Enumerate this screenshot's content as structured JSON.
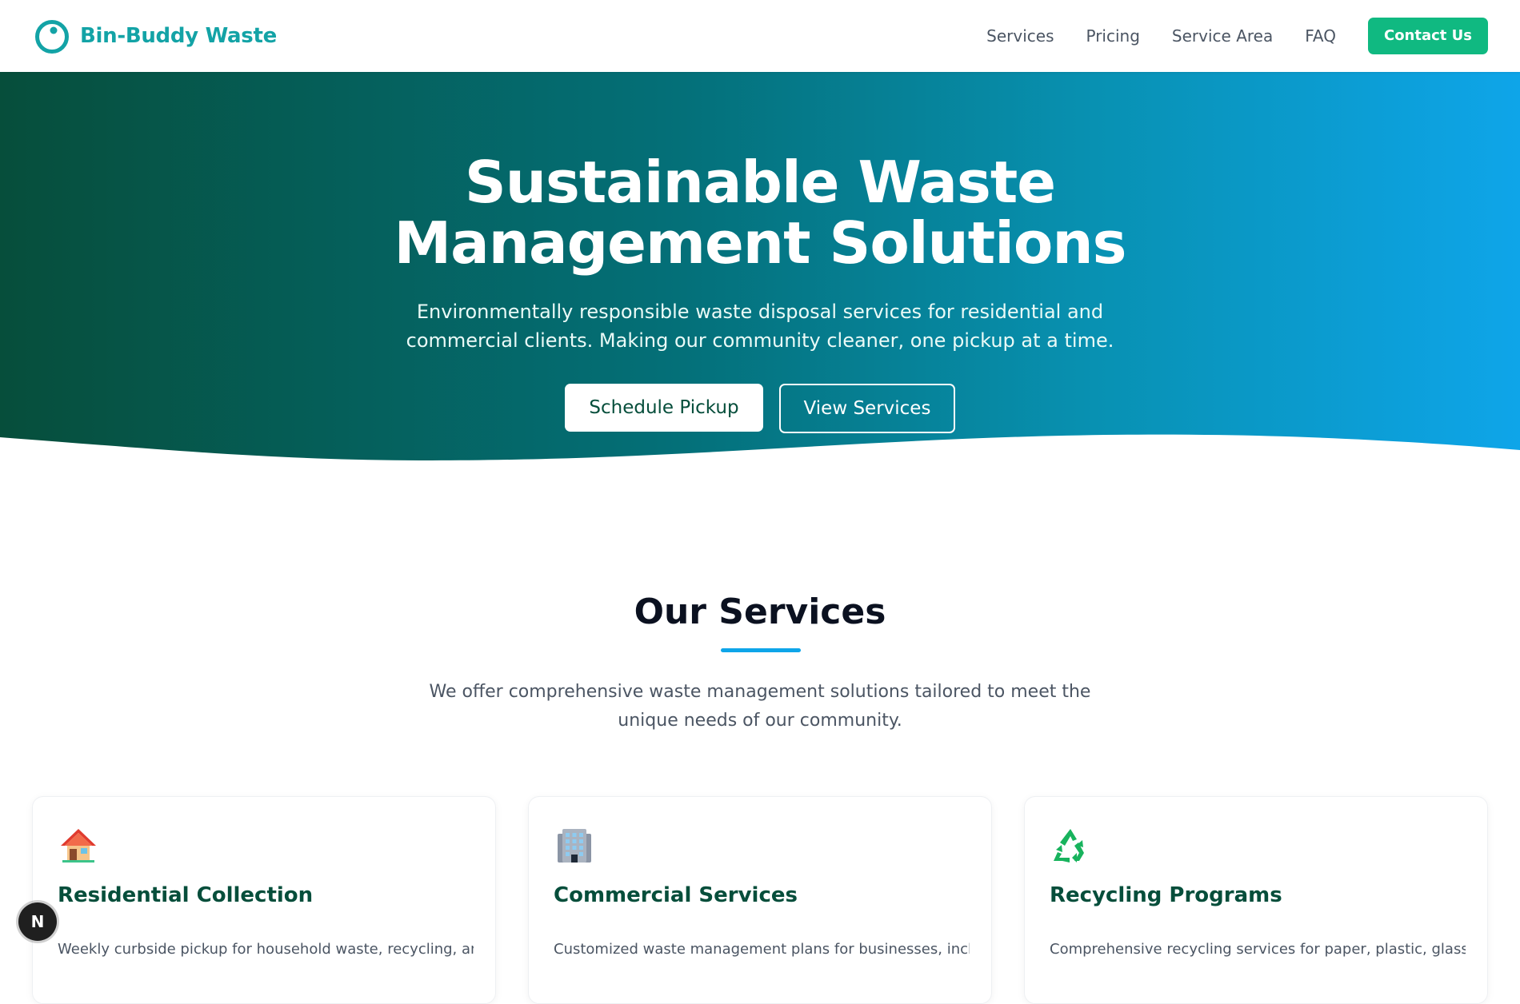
{
  "nav": {
    "brand_name": "Bin-Buddy Waste",
    "links": [
      "Services",
      "Pricing",
      "Service Area",
      "FAQ"
    ],
    "cta_label": "Contact Us"
  },
  "hero": {
    "title_line1": "Sustainable Waste",
    "title_line2": "Management Solutions",
    "subtitle": "Environmentally responsible waste disposal services for residential and commercial clients. Making our community cleaner, one pickup at a time.",
    "primary_button": "Schedule Pickup",
    "secondary_button": "View Services"
  },
  "services": {
    "title": "Our Services",
    "intro": "We offer comprehensive waste management solutions tailored to meet the unique needs of our community.",
    "cards": [
      {
        "icon": "house-icon",
        "title": "Residential Collection",
        "description": "Weekly curbside pickup for household waste, recycling, and yard"
      },
      {
        "icon": "office-building-icon",
        "title": "Commercial Services",
        "description": "Customized waste management plans for businesses, including"
      },
      {
        "icon": "recycle-icon",
        "title": "Recycling Programs",
        "description": "Comprehensive recycling services for paper, plastic, glass, metal,"
      }
    ]
  },
  "dev_badge": {
    "label": "N"
  },
  "colors": {
    "brand": "#13a3a6",
    "cta": "#10b981",
    "hero_start": "#064e3b",
    "hero_end": "#0ea5e9",
    "heading_dark": "#064e3b",
    "accent_underline": "#0ea5e9"
  }
}
